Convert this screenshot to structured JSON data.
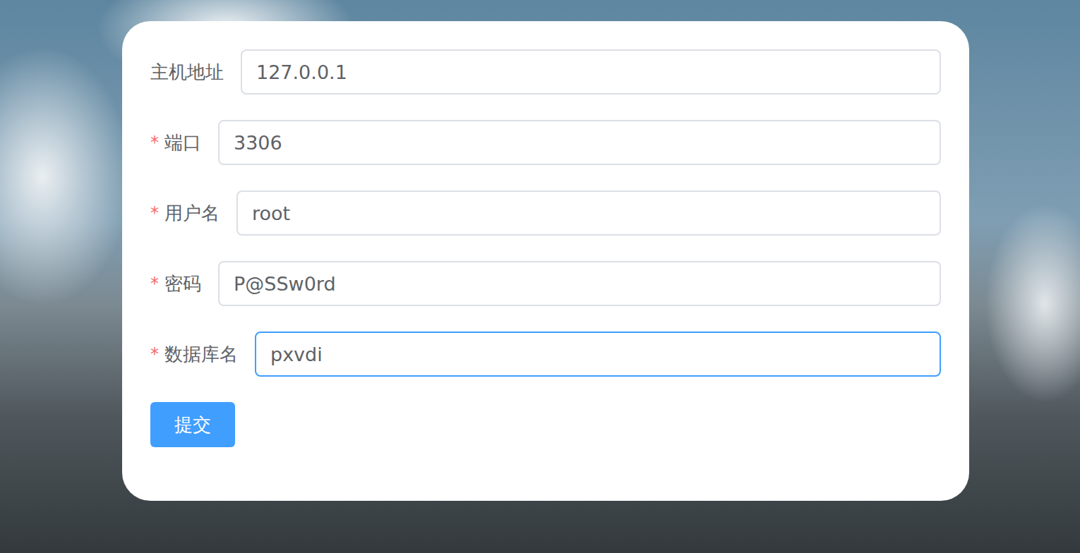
{
  "form": {
    "fields": [
      {
        "label": "主机地址",
        "value": "127.0.0.1",
        "required": false,
        "focused": false
      },
      {
        "label": "端口",
        "value": "3306",
        "required": true,
        "focused": false
      },
      {
        "label": "用户名",
        "value": "root",
        "required": true,
        "focused": false
      },
      {
        "label": "密码",
        "value": "P@SSw0rd",
        "required": true,
        "focused": false
      },
      {
        "label": "数据库名",
        "value": "pxvdi",
        "required": true,
        "focused": true
      }
    ],
    "required_mark": "*",
    "submit": "提交"
  }
}
